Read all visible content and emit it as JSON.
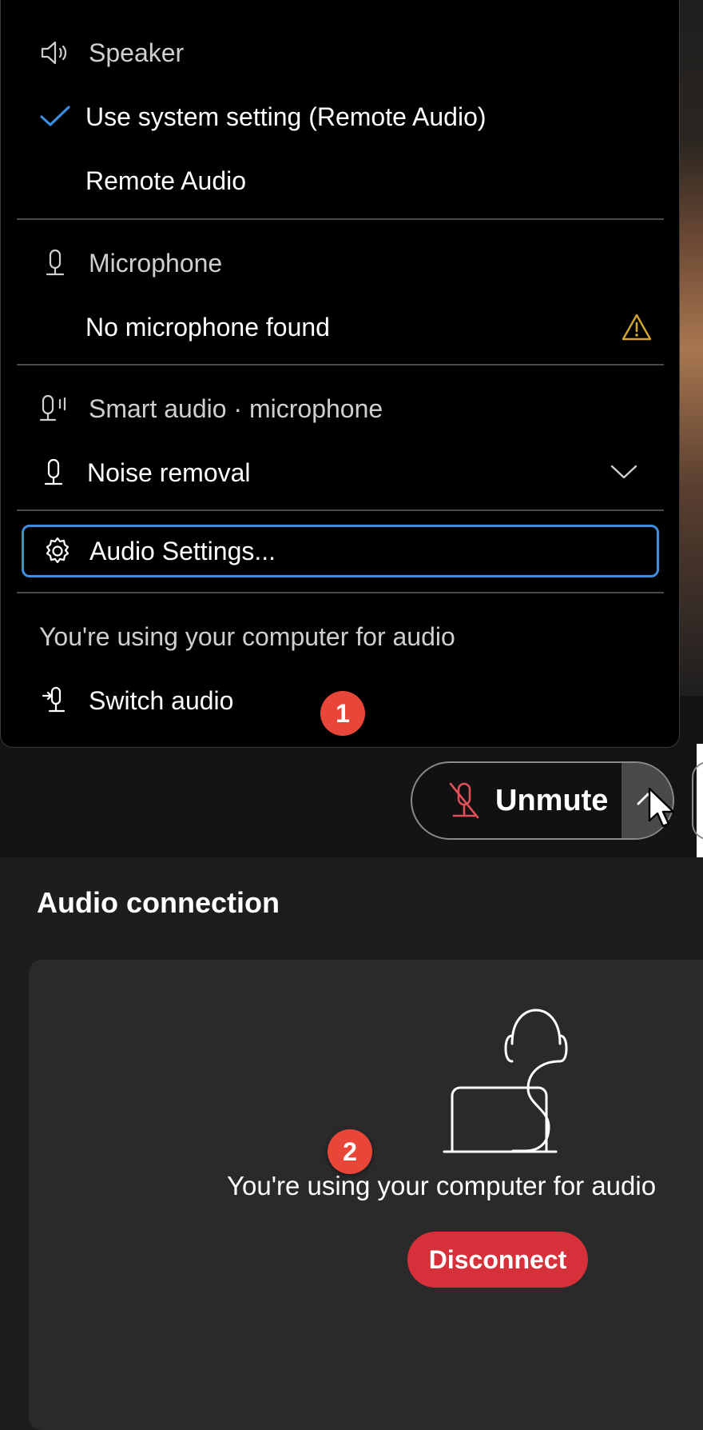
{
  "menu": {
    "speaker_header": "Speaker",
    "speaker_options": [
      {
        "label": "Use system setting (Remote Audio)",
        "selected": true
      },
      {
        "label": "Remote Audio",
        "selected": false
      }
    ],
    "microphone_header": "Microphone",
    "microphone_status": "No microphone found",
    "smart_audio_header": "Smart audio · microphone",
    "noise_removal_label": "Noise removal",
    "audio_settings_label": "Audio Settings...",
    "using_computer_text": "You're using your computer for audio",
    "switch_audio_label": "Switch audio",
    "accent_color": "#3d8ee0",
    "warning_color": "#d4a72c"
  },
  "controls": {
    "unmute_label": "Unmute"
  },
  "callouts": [
    "1",
    "2"
  ],
  "connection": {
    "title": "Audio connection",
    "status_text": "You're using your computer for audio",
    "disconnect_label": "Disconnect",
    "disconnect_color": "#d6303a"
  }
}
